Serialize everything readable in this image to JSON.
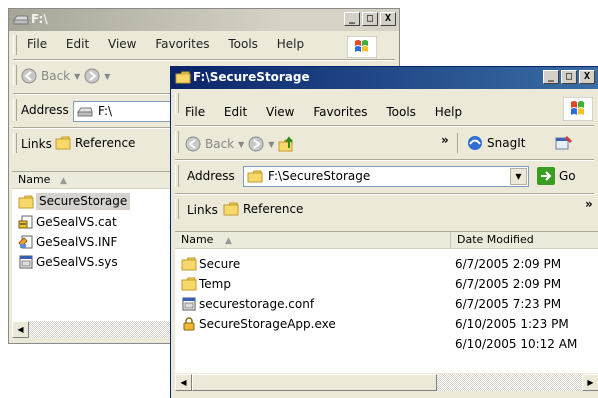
{
  "back_window": {
    "title": "F:\\",
    "menu": [
      "File",
      "Edit",
      "View",
      "Favorites",
      "Tools",
      "Help"
    ],
    "toolbar": {
      "back_label": "Back"
    },
    "address": {
      "label": "Address",
      "value": "F:\\"
    },
    "links": {
      "label": "Links",
      "item": "Reference"
    },
    "columns": {
      "name": "Name"
    },
    "files": [
      {
        "name": "SecureStorage",
        "icon": "folder-icon",
        "selected": true
      },
      {
        "name": "GeSealVS.cat",
        "icon": "catalog-file-icon"
      },
      {
        "name": "GeSealVS.INF",
        "icon": "setup-info-file-icon"
      },
      {
        "name": "GeSealVS.sys",
        "icon": "system-file-icon"
      }
    ]
  },
  "front_window": {
    "title": "F:\\SecureStorage",
    "menu": [
      "File",
      "Edit",
      "View",
      "Favorites",
      "Tools",
      "Help"
    ],
    "toolbar": {
      "back_label": "Back",
      "more": "»",
      "snagit_label": "SnagIt"
    },
    "address": {
      "label": "Address",
      "value": "F:\\SecureStorage",
      "go_label": "Go"
    },
    "links": {
      "label": "Links",
      "item": "Reference",
      "more": "»"
    },
    "columns": {
      "name": "Name",
      "date_modified": "Date Modified"
    },
    "files": [
      {
        "name": "Secure",
        "date": "6/7/2005 2:09 PM",
        "icon": "folder-icon"
      },
      {
        "name": "Temp",
        "date": "6/7/2005 2:09 PM",
        "icon": "folder-icon"
      },
      {
        "name": "securestorage.conf",
        "date": "6/7/2005 7:23 PM",
        "icon": "config-file-icon"
      },
      {
        "name": "SecureStorageApp.exe",
        "date": "6/10/2005 1:23 PM",
        "icon": "lock-app-icon"
      },
      {
        "name": "",
        "date": "6/10/2005 10:12 AM",
        "icon": ""
      }
    ]
  },
  "title_buttons": {
    "minimize": "_",
    "maximize": "□",
    "close": "X"
  },
  "colors": {
    "inactive_title": "#c6c3b5",
    "active_title_start": "#0a246a",
    "active_title_end": "#3a6ea5",
    "folder": "#f4d35e",
    "go_green": "#3a9d23"
  }
}
